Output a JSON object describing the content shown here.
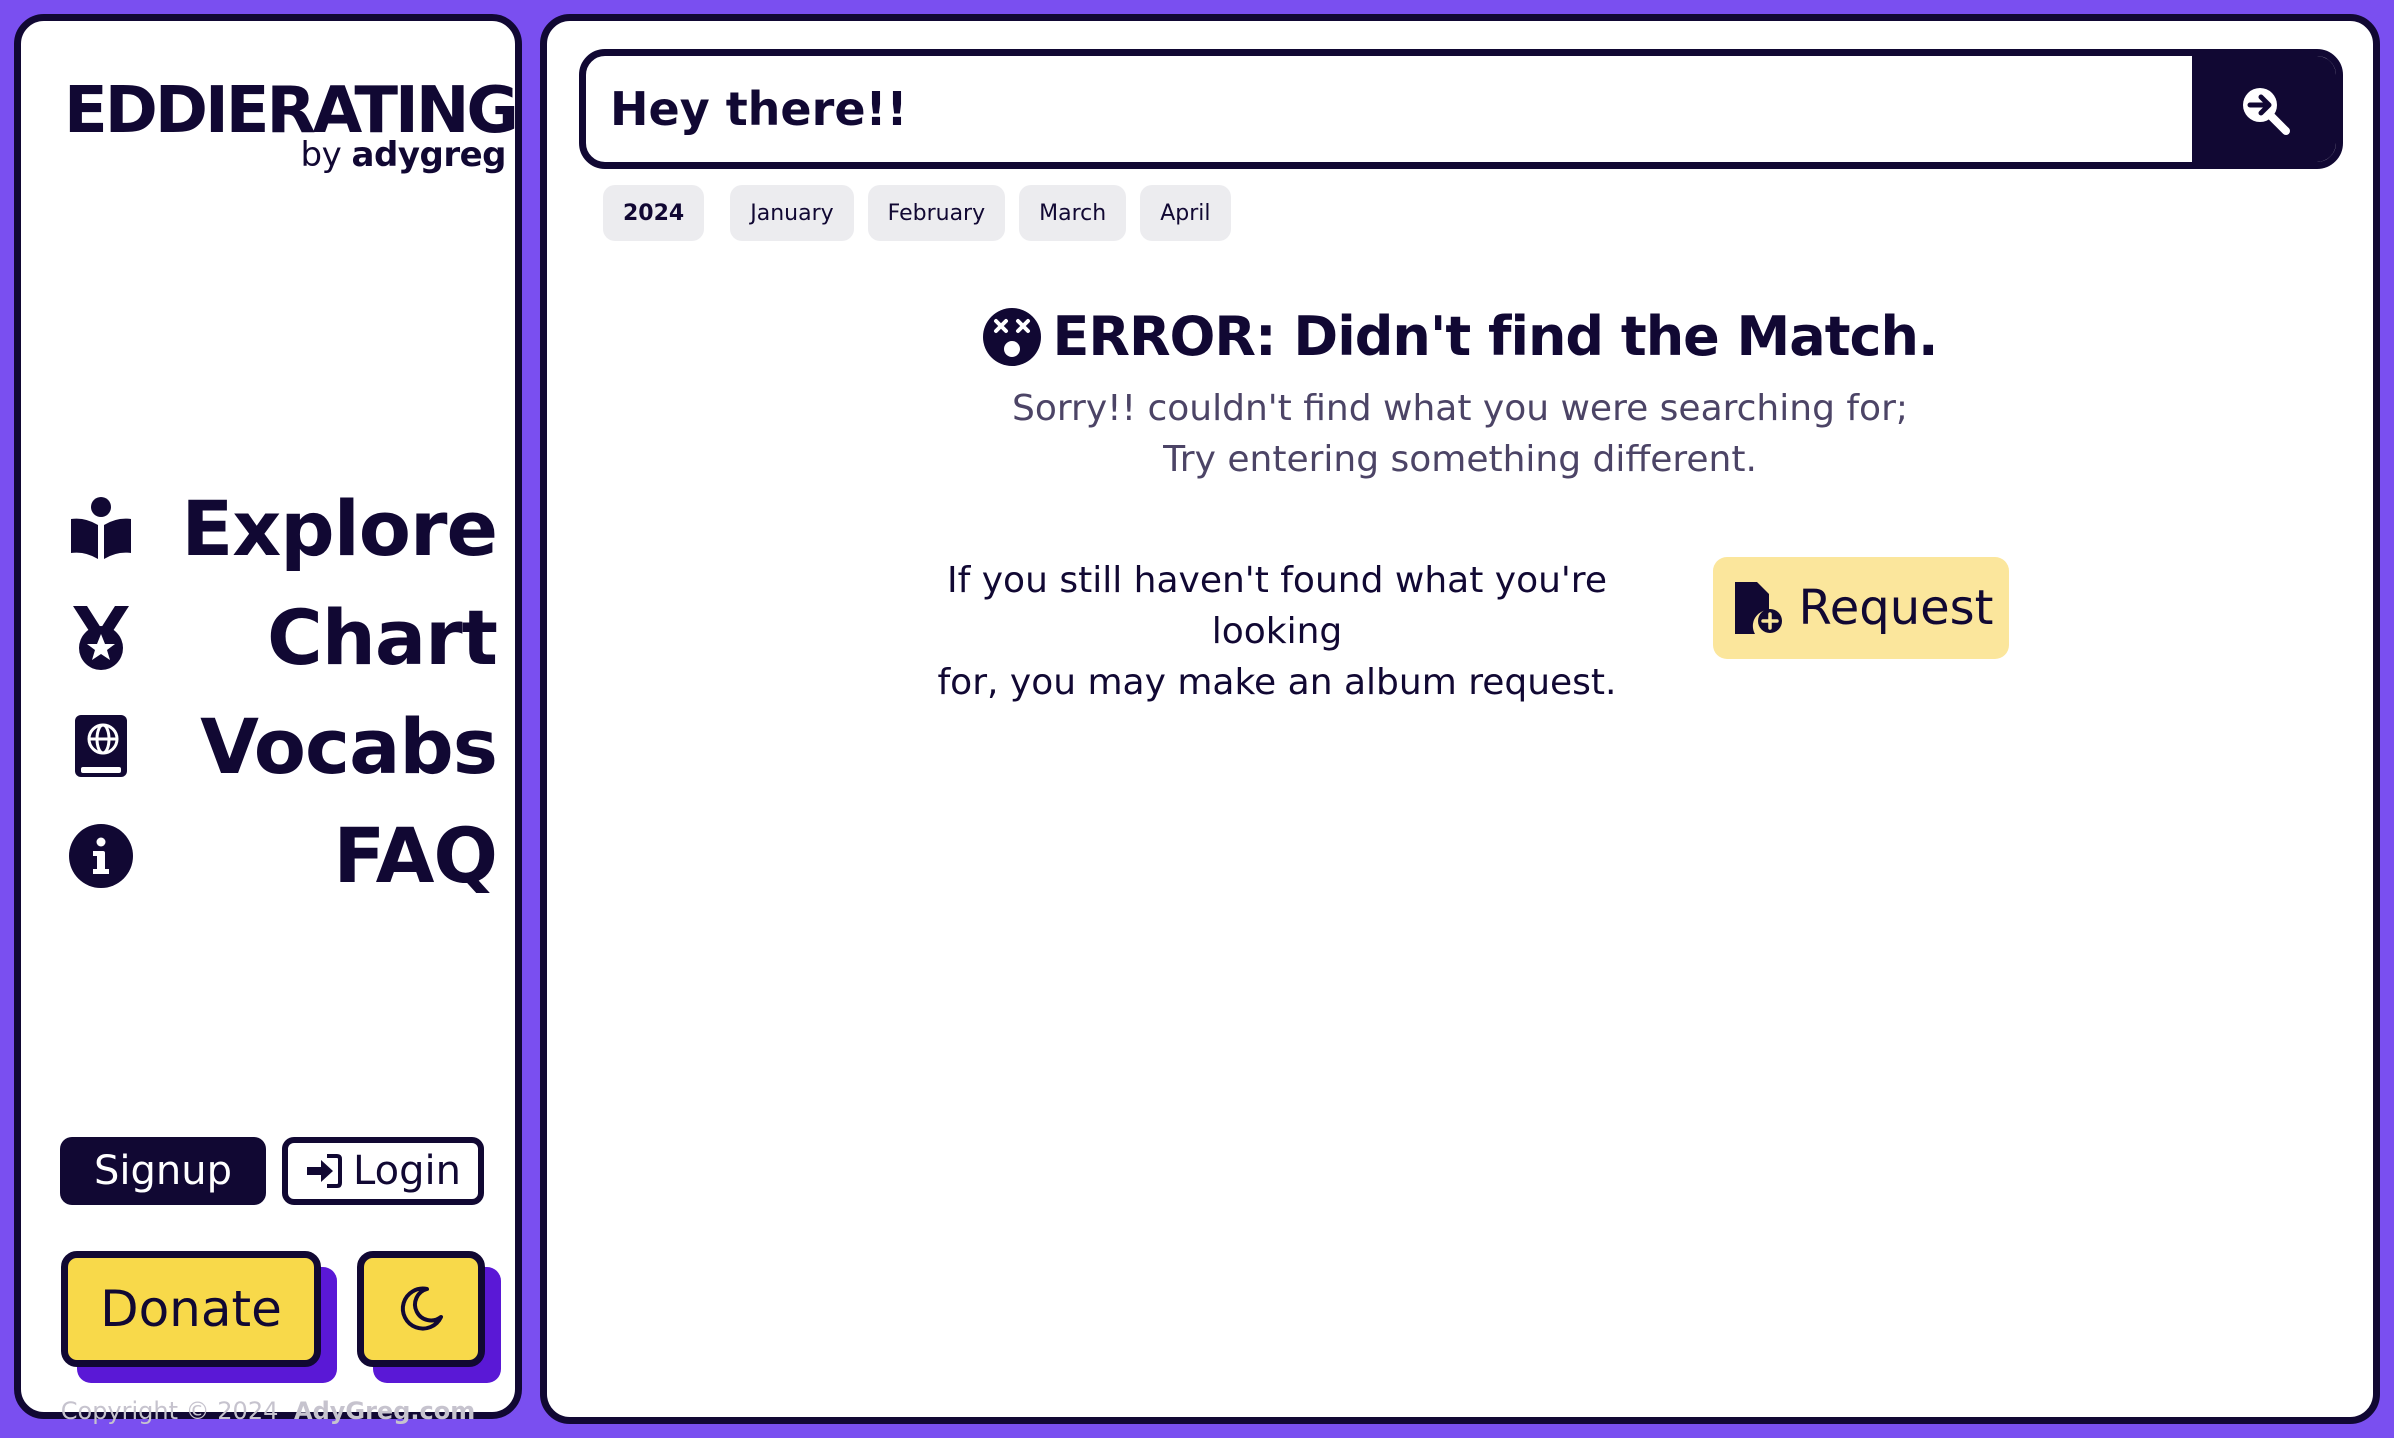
{
  "brand": {
    "title": "EDDIERATING",
    "sub_prefix": "by",
    "sub_name": "adygreg"
  },
  "nav": [
    {
      "label": "Explore",
      "icon": "book-reader-icon"
    },
    {
      "label": "Chart",
      "icon": "medal-icon"
    },
    {
      "label": "Vocabs",
      "icon": "globe-book-icon"
    },
    {
      "label": "FAQ",
      "icon": "info-icon"
    }
  ],
  "auth": {
    "signup": "Signup",
    "login": "Login"
  },
  "donate": "Donate",
  "theme_icon": "moon-icon",
  "copyright": {
    "text": "Copyright © 2024",
    "link": "AdyGreg.com"
  },
  "search": {
    "value": "Hey there!!",
    "button_icon": "search-arrow-icon"
  },
  "chips": [
    "2024",
    "January",
    "February",
    "March",
    "April"
  ],
  "error": {
    "icon": "dizzy-face-icon",
    "title": "ERROR: Didn't find the Match.",
    "line1": "Sorry!! couldn't find what you were searching for;",
    "line2": "Try entering something different."
  },
  "request": {
    "text_line1": "If you still haven't found what you're looking",
    "text_line2": "for, you may make an album request.",
    "button": "Request",
    "button_icon": "file-plus-icon"
  },
  "colors": {
    "background": "#7a4ff0",
    "ink": "#110833",
    "donate": "#f8d94a",
    "request": "#fbe69c"
  }
}
